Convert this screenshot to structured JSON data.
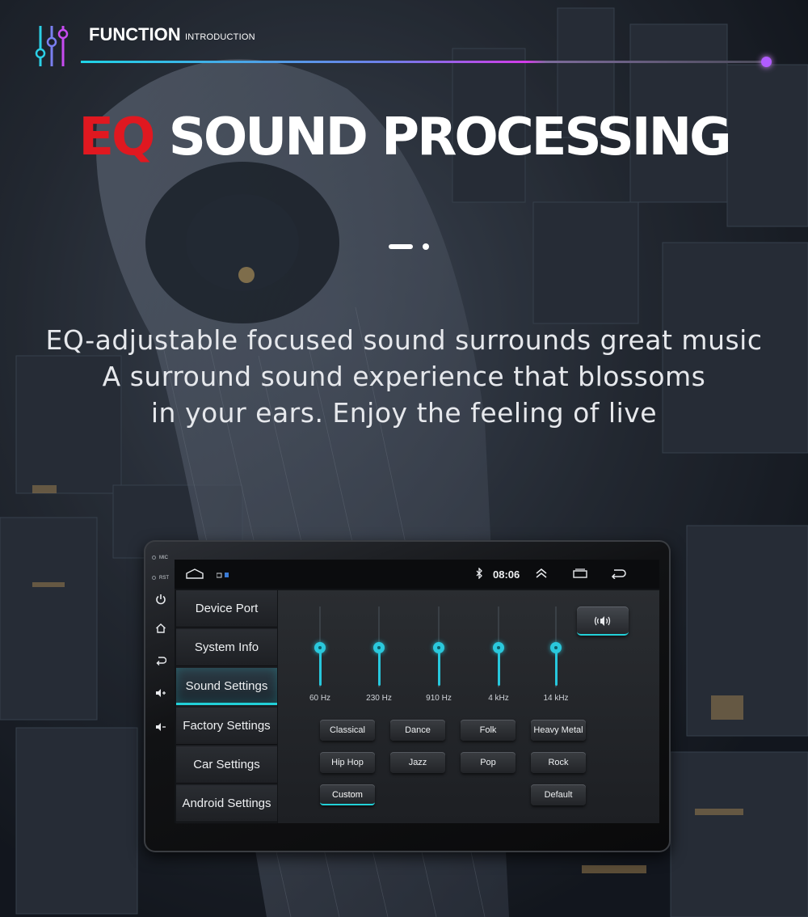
{
  "header": {
    "brand_title": "FUNCTION",
    "brand_subtitle": "INTRODUCTION"
  },
  "headline": {
    "accent": "EQ",
    "main": "SOUND PROCESSING",
    "accent_color": "#e01820"
  },
  "tagline": [
    "EQ-adjustable focused sound surrounds great music",
    "A surround sound experience that blossoms",
    "in your ears. Enjoy the feeling of live"
  ],
  "device": {
    "hw_labels": {
      "mic": "MIC",
      "rst": "RST"
    },
    "hw_buttons": [
      "power-icon",
      "home-icon",
      "back-icon",
      "volume-up-icon",
      "volume-down-icon"
    ],
    "status_bar": {
      "time": "08:06",
      "icons": [
        "home-outline-icon",
        "notification-icon",
        "bluetooth-icon",
        "chevron-up-icon",
        "recent-apps-icon",
        "back-arrow-icon"
      ]
    },
    "sidebar": [
      {
        "label": "Device Port",
        "active": false
      },
      {
        "label": "System Info",
        "active": false
      },
      {
        "label": "Sound Settings",
        "active": true
      },
      {
        "label": "Factory Settings",
        "active": false
      },
      {
        "label": "Car Settings",
        "active": false
      },
      {
        "label": "Android Settings",
        "active": false
      }
    ],
    "equalizer": {
      "bands": [
        "60 Hz",
        "230 Hz",
        "910 Hz",
        "4 kHz",
        "14 kHz"
      ],
      "presets": [
        {
          "label": "Classical",
          "active": false
        },
        {
          "label": "Dance",
          "active": false
        },
        {
          "label": "Folk",
          "active": false
        },
        {
          "label": "Heavy Metal",
          "active": false
        },
        {
          "label": "Hip Hop",
          "active": false
        },
        {
          "label": "Jazz",
          "active": false
        },
        {
          "label": "Pop",
          "active": false
        },
        {
          "label": "Rock",
          "active": false
        },
        {
          "label": "Custom",
          "active": true
        },
        {
          "label": "Default",
          "active": false
        }
      ],
      "sound_effect_icon": "speaker-wave-icon",
      "accent_color": "#22d0d8"
    }
  }
}
